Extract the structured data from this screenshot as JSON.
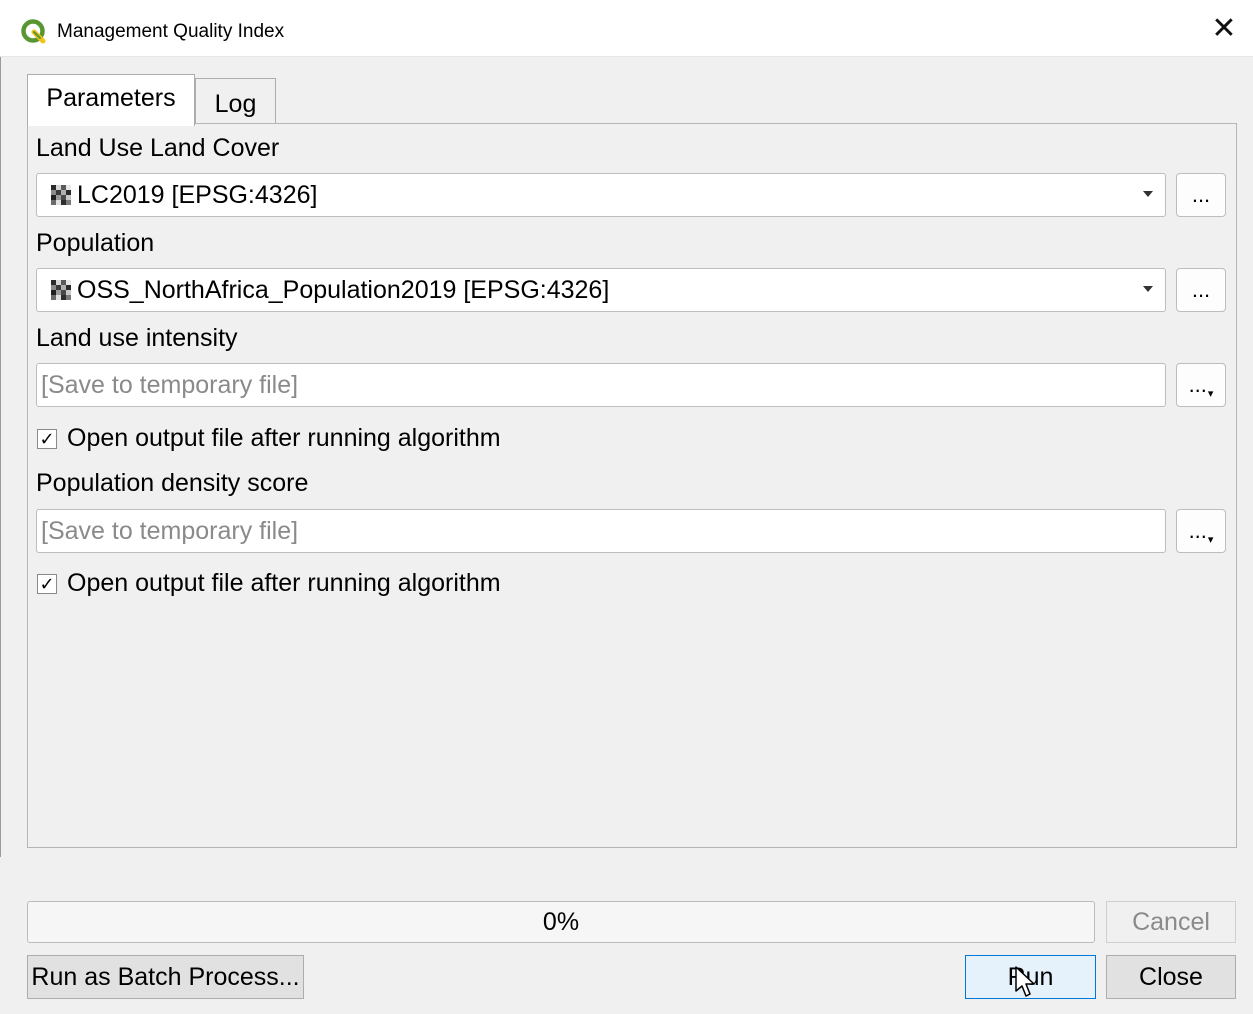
{
  "window": {
    "title": "Management Quality Index",
    "close_glyph": "✕"
  },
  "tabs": [
    {
      "label": "Parameters",
      "active": true
    },
    {
      "label": "Log",
      "active": false
    }
  ],
  "parameters": {
    "land_use_label": "Land Use Land Cover",
    "land_use_value": "LC2019 [EPSG:4326]",
    "population_label": "Population",
    "population_value": "OSS_NorthAfrica_Population2019 [EPSG:4326]",
    "intensity_label": "Land use intensity",
    "intensity_placeholder": "[Save to temporary file]",
    "intensity_open_label": "Open output file after running algorithm",
    "intensity_open_checked": true,
    "density_label": "Population density score",
    "density_placeholder": "[Save to temporary file]",
    "density_open_label": "Open output file after running algorithm",
    "density_open_checked": true,
    "browse_label": "..."
  },
  "progress": {
    "value": 0,
    "text": "0%"
  },
  "buttons": {
    "cancel": "Cancel",
    "batch": "Run as Batch Process...",
    "run": "Run",
    "close": "Close"
  },
  "colors": {
    "qgis_green": "#589632",
    "qgis_yellow": "#f0c419",
    "default_button_border": "#0078d7"
  }
}
